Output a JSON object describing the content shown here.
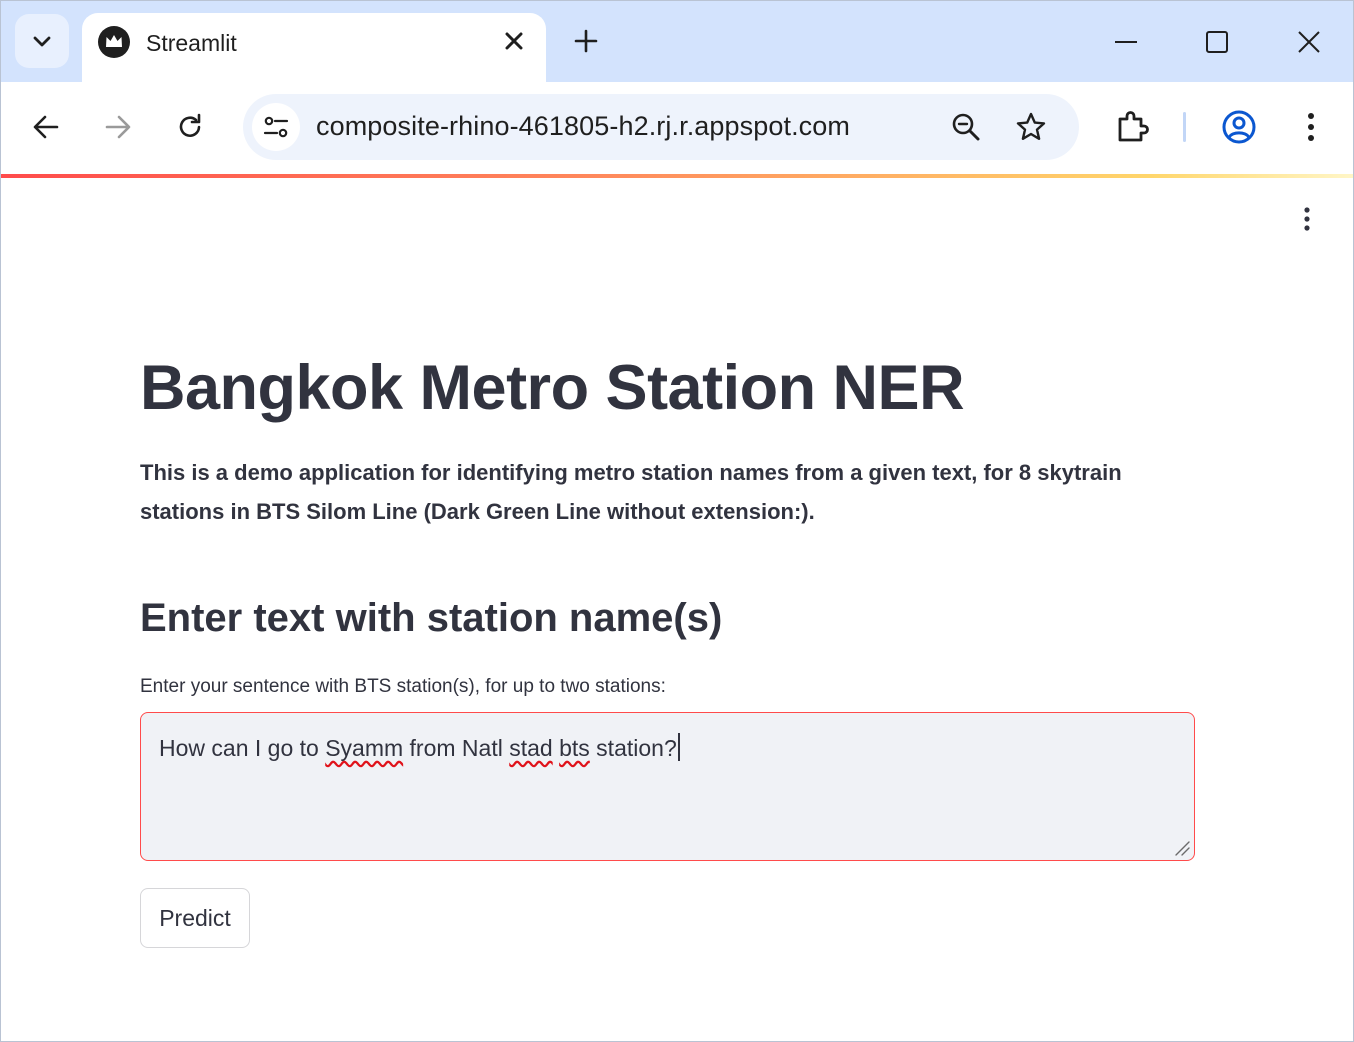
{
  "browser": {
    "tab": {
      "title": "Streamlit"
    },
    "address_bar": {
      "url": "composite-rhino-461805-h2.rj.r.appspot.com"
    },
    "icons": [
      "tab-search-icon",
      "streamlit-crown-icon",
      "close-icon",
      "plus-icon",
      "minimize-icon",
      "maximize-icon",
      "window-close-icon",
      "back-arrow-icon",
      "forward-arrow-icon",
      "reload-icon",
      "site-info-icon",
      "zoom-icon",
      "star-icon",
      "extensions-icon",
      "profile-icon",
      "kebab-menu-icon"
    ],
    "colors": {
      "titlebar": "#d3e3fd",
      "omnibox": "#eef3fc",
      "profile": "#0b57d0"
    }
  },
  "page": {
    "title": "Bangkok Metro Station NER",
    "description": "This is a demo application for identifying metro station names from a given text, for 8 skytrain stations in BTS Silom Line (Dark Green Line without extension:).",
    "subheader": "Enter text with station name(s)",
    "input": {
      "label": "Enter your sentence with BTS station(s), for up to two stations:",
      "value_segments": [
        "How can I go to ",
        "Syamm",
        " from Natl ",
        "stad",
        " ",
        "bts",
        " station?"
      ]
    },
    "predict_button": "Predict",
    "colors": {
      "accent": "#ff4b4b",
      "text": "#31333f",
      "input_bg": "#f0f2f6",
      "spellcheck": "#e0131b"
    }
  }
}
